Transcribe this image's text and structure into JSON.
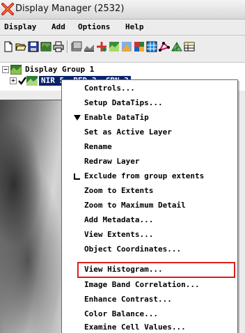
{
  "window": {
    "title": "Display Manager (2532)",
    "app_icon": "x-tnt-icon"
  },
  "menubar": {
    "items": [
      "Display",
      "Add",
      "Options",
      "Help"
    ]
  },
  "toolbar": {
    "icons": [
      "new-icon",
      "open-folder-icon",
      "save-icon",
      "layer-controls-icon",
      "print-icon",
      "group-icon",
      "layout-icon",
      "add-layer-icon",
      "add-raster-icon",
      "open-3d-icon",
      "raster-composite-icon",
      "tile-set-icon",
      "vector-layer-icon",
      "tin-icon",
      "table-icon"
    ]
  },
  "tree": {
    "group_label": "Display Group 1",
    "layer_label": "NIR 5, RED 3, GRN 2"
  },
  "context_menu": {
    "items": [
      {
        "label": "Controls...",
        "mark": ""
      },
      {
        "label": "Setup DataTips...",
        "mark": ""
      },
      {
        "label": "Enable DataTip",
        "mark": "check"
      },
      {
        "label": "Set as Active Layer",
        "mark": ""
      },
      {
        "label": "Rename",
        "mark": ""
      },
      {
        "label": "Redraw Layer",
        "mark": ""
      },
      {
        "label": "Exclude from group extents",
        "mark": "box"
      },
      {
        "label": "Zoom to Extents",
        "mark": ""
      },
      {
        "label": "Zoom to Maximum Detail",
        "mark": ""
      },
      {
        "label": "Add Metadata...",
        "mark": ""
      },
      {
        "label": "View Extents...",
        "mark": ""
      },
      {
        "label": "Object Coordinates...",
        "mark": ""
      },
      {
        "label": "View Histogram...",
        "mark": ""
      },
      {
        "label": "Image Band Correlation...",
        "mark": ""
      },
      {
        "label": "Enhance Contrast...",
        "mark": ""
      },
      {
        "label": "Color Balance...",
        "mark": ""
      },
      {
        "label": "Examine Cell Values...",
        "mark": ""
      }
    ],
    "highlighted_item": "View Histogram...",
    "highlight_color": "#e01b1b"
  },
  "colors": {
    "selection": "#0a246a",
    "menu_bg": "#ffffff",
    "chrome_bg": "#ececec"
  }
}
